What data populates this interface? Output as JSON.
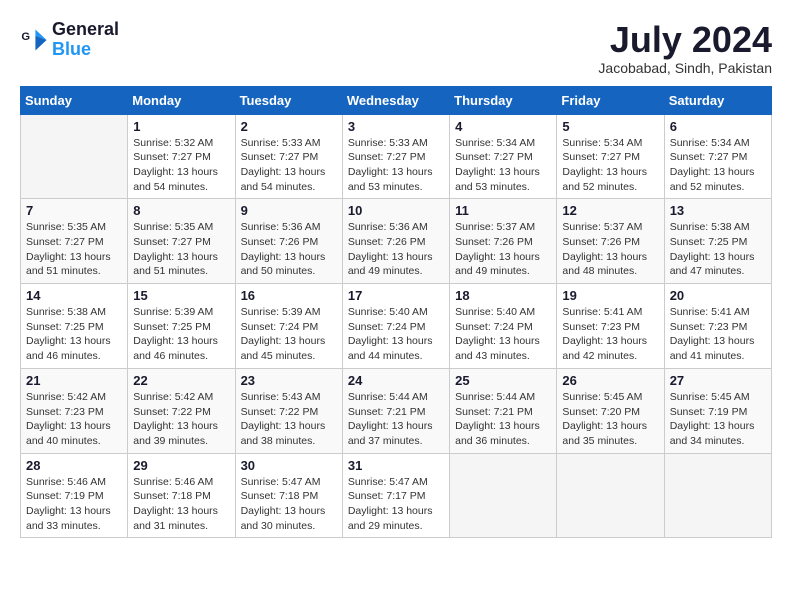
{
  "logo": {
    "line1": "General",
    "line2": "Blue"
  },
  "title": "July 2024",
  "location": "Jacobabad, Sindh, Pakistan",
  "columns": [
    "Sunday",
    "Monday",
    "Tuesday",
    "Wednesday",
    "Thursday",
    "Friday",
    "Saturday"
  ],
  "weeks": [
    [
      {
        "num": "",
        "info": ""
      },
      {
        "num": "1",
        "info": "Sunrise: 5:32 AM\nSunset: 7:27 PM\nDaylight: 13 hours\nand 54 minutes."
      },
      {
        "num": "2",
        "info": "Sunrise: 5:33 AM\nSunset: 7:27 PM\nDaylight: 13 hours\nand 54 minutes."
      },
      {
        "num": "3",
        "info": "Sunrise: 5:33 AM\nSunset: 7:27 PM\nDaylight: 13 hours\nand 53 minutes."
      },
      {
        "num": "4",
        "info": "Sunrise: 5:34 AM\nSunset: 7:27 PM\nDaylight: 13 hours\nand 53 minutes."
      },
      {
        "num": "5",
        "info": "Sunrise: 5:34 AM\nSunset: 7:27 PM\nDaylight: 13 hours\nand 52 minutes."
      },
      {
        "num": "6",
        "info": "Sunrise: 5:34 AM\nSunset: 7:27 PM\nDaylight: 13 hours\nand 52 minutes."
      }
    ],
    [
      {
        "num": "7",
        "info": "Sunrise: 5:35 AM\nSunset: 7:27 PM\nDaylight: 13 hours\nand 51 minutes."
      },
      {
        "num": "8",
        "info": "Sunrise: 5:35 AM\nSunset: 7:27 PM\nDaylight: 13 hours\nand 51 minutes."
      },
      {
        "num": "9",
        "info": "Sunrise: 5:36 AM\nSunset: 7:26 PM\nDaylight: 13 hours\nand 50 minutes."
      },
      {
        "num": "10",
        "info": "Sunrise: 5:36 AM\nSunset: 7:26 PM\nDaylight: 13 hours\nand 49 minutes."
      },
      {
        "num": "11",
        "info": "Sunrise: 5:37 AM\nSunset: 7:26 PM\nDaylight: 13 hours\nand 49 minutes."
      },
      {
        "num": "12",
        "info": "Sunrise: 5:37 AM\nSunset: 7:26 PM\nDaylight: 13 hours\nand 48 minutes."
      },
      {
        "num": "13",
        "info": "Sunrise: 5:38 AM\nSunset: 7:25 PM\nDaylight: 13 hours\nand 47 minutes."
      }
    ],
    [
      {
        "num": "14",
        "info": "Sunrise: 5:38 AM\nSunset: 7:25 PM\nDaylight: 13 hours\nand 46 minutes."
      },
      {
        "num": "15",
        "info": "Sunrise: 5:39 AM\nSunset: 7:25 PM\nDaylight: 13 hours\nand 46 minutes."
      },
      {
        "num": "16",
        "info": "Sunrise: 5:39 AM\nSunset: 7:24 PM\nDaylight: 13 hours\nand 45 minutes."
      },
      {
        "num": "17",
        "info": "Sunrise: 5:40 AM\nSunset: 7:24 PM\nDaylight: 13 hours\nand 44 minutes."
      },
      {
        "num": "18",
        "info": "Sunrise: 5:40 AM\nSunset: 7:24 PM\nDaylight: 13 hours\nand 43 minutes."
      },
      {
        "num": "19",
        "info": "Sunrise: 5:41 AM\nSunset: 7:23 PM\nDaylight: 13 hours\nand 42 minutes."
      },
      {
        "num": "20",
        "info": "Sunrise: 5:41 AM\nSunset: 7:23 PM\nDaylight: 13 hours\nand 41 minutes."
      }
    ],
    [
      {
        "num": "21",
        "info": "Sunrise: 5:42 AM\nSunset: 7:23 PM\nDaylight: 13 hours\nand 40 minutes."
      },
      {
        "num": "22",
        "info": "Sunrise: 5:42 AM\nSunset: 7:22 PM\nDaylight: 13 hours\nand 39 minutes."
      },
      {
        "num": "23",
        "info": "Sunrise: 5:43 AM\nSunset: 7:22 PM\nDaylight: 13 hours\nand 38 minutes."
      },
      {
        "num": "24",
        "info": "Sunrise: 5:44 AM\nSunset: 7:21 PM\nDaylight: 13 hours\nand 37 minutes."
      },
      {
        "num": "25",
        "info": "Sunrise: 5:44 AM\nSunset: 7:21 PM\nDaylight: 13 hours\nand 36 minutes."
      },
      {
        "num": "26",
        "info": "Sunrise: 5:45 AM\nSunset: 7:20 PM\nDaylight: 13 hours\nand 35 minutes."
      },
      {
        "num": "27",
        "info": "Sunrise: 5:45 AM\nSunset: 7:19 PM\nDaylight: 13 hours\nand 34 minutes."
      }
    ],
    [
      {
        "num": "28",
        "info": "Sunrise: 5:46 AM\nSunset: 7:19 PM\nDaylight: 13 hours\nand 33 minutes."
      },
      {
        "num": "29",
        "info": "Sunrise: 5:46 AM\nSunset: 7:18 PM\nDaylight: 13 hours\nand 31 minutes."
      },
      {
        "num": "30",
        "info": "Sunrise: 5:47 AM\nSunset: 7:18 PM\nDaylight: 13 hours\nand 30 minutes."
      },
      {
        "num": "31",
        "info": "Sunrise: 5:47 AM\nSunset: 7:17 PM\nDaylight: 13 hours\nand 29 minutes."
      },
      {
        "num": "",
        "info": ""
      },
      {
        "num": "",
        "info": ""
      },
      {
        "num": "",
        "info": ""
      }
    ]
  ]
}
